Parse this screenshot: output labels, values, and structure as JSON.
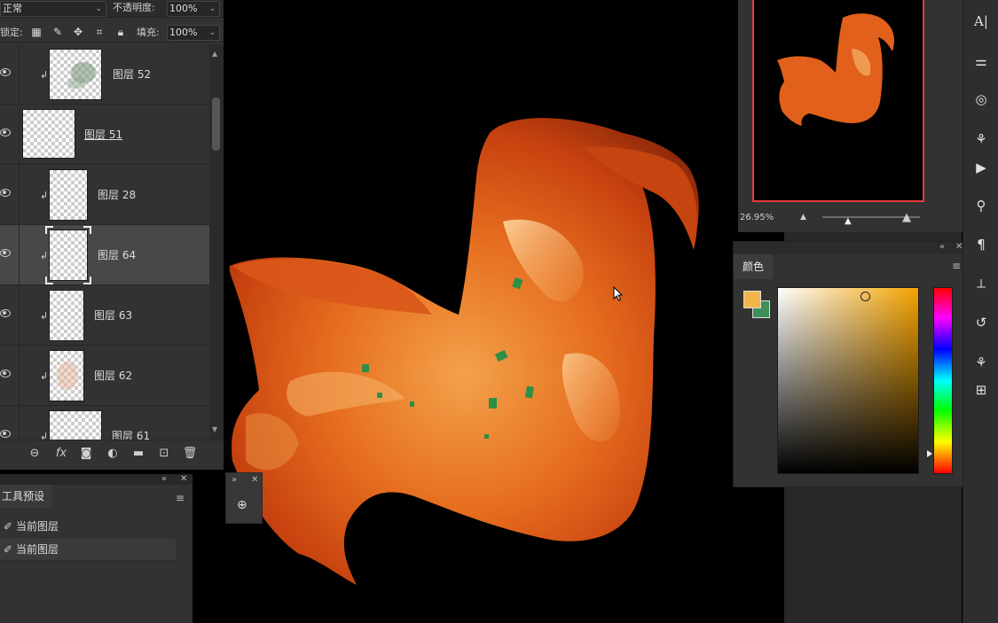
{
  "layers_panel": {
    "blend_mode": "正常",
    "opacity_label": "不透明度:",
    "opacity_value": "100%",
    "lock_label": "锁定:",
    "fill_label": "填充:",
    "fill_value": "100%",
    "layers": [
      {
        "name": "图层 52",
        "visible": true,
        "clipped": true,
        "selected": false
      },
      {
        "name": "图层 51",
        "visible": true,
        "clipped": false,
        "selected": false
      },
      {
        "name": "图层 28",
        "visible": true,
        "clipped": true,
        "selected": false
      },
      {
        "name": "图层 64",
        "visible": true,
        "clipped": true,
        "selected": true
      },
      {
        "name": "图层 63",
        "visible": true,
        "clipped": true,
        "selected": false
      },
      {
        "name": "图层 62",
        "visible": true,
        "clipped": true,
        "selected": false
      },
      {
        "name": "图层 61",
        "visible": true,
        "clipped": true,
        "selected": false
      }
    ],
    "footer_icons": [
      "link-icon",
      "fx-icon",
      "mask-icon",
      "adjustment-icon",
      "folder-icon",
      "new-layer-icon",
      "trash-icon"
    ],
    "fx_label": "fx"
  },
  "tool_presets": {
    "title": "工具预设",
    "items": [
      "当前图层",
      "当前图层"
    ]
  },
  "navigator": {
    "zoom": "26.95%"
  },
  "color_panel": {
    "title": "颜色",
    "foreground": "#f2b54a",
    "background": "#3f8f5a",
    "hue_color": "#f5a300"
  },
  "toolbar": {
    "icons": [
      "character-icon",
      "adjustments-icon",
      "3d-icon",
      "brush-settings-icon",
      "play-icon",
      "clone-source-icon",
      "paragraph-icon",
      "path-icon",
      "history-icon",
      "channels-icon",
      "properties-icon"
    ]
  }
}
